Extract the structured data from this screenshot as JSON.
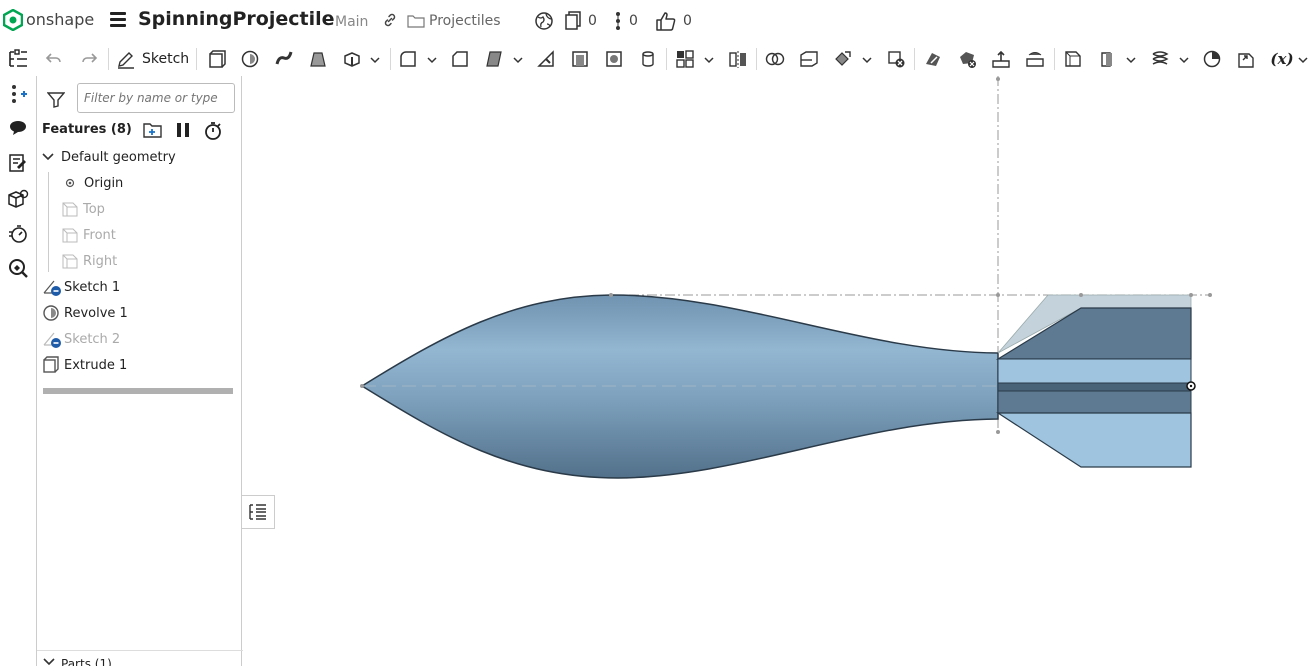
{
  "app": {
    "name": "onshape",
    "accent": "#00a651"
  },
  "document": {
    "title": "SpinningProjectile",
    "branch": "Main",
    "folder": "Projectiles"
  },
  "stats": {
    "versions": "0",
    "branches": "0",
    "likes": "0"
  },
  "toolbar": {
    "sketch_label": "Sketch",
    "variable_label": "(x)"
  },
  "panel": {
    "filter_placeholder": "Filter by name or type",
    "features_title": "Features (8)",
    "default_geometry": "Default geometry",
    "items": [
      {
        "label": "Origin",
        "icon": "origin-icon",
        "dim": false
      },
      {
        "label": "Top",
        "icon": "plane-icon",
        "dim": true
      },
      {
        "label": "Front",
        "icon": "plane-icon",
        "dim": true
      },
      {
        "label": "Right",
        "icon": "plane-icon",
        "dim": true
      }
    ],
    "features": [
      {
        "label": "Sketch 1",
        "icon": "sketch-icon",
        "dim": false
      },
      {
        "label": "Revolve 1",
        "icon": "revolve-icon",
        "dim": false
      },
      {
        "label": "Sketch 2",
        "icon": "sketch-icon",
        "dim": true
      },
      {
        "label": "Extrude 1",
        "icon": "extrude-icon",
        "dim": false
      }
    ],
    "parts_label": "Parts (1)"
  },
  "colors": {
    "model_body": "#7fa3bf",
    "model_edge": "#2a3a48"
  }
}
